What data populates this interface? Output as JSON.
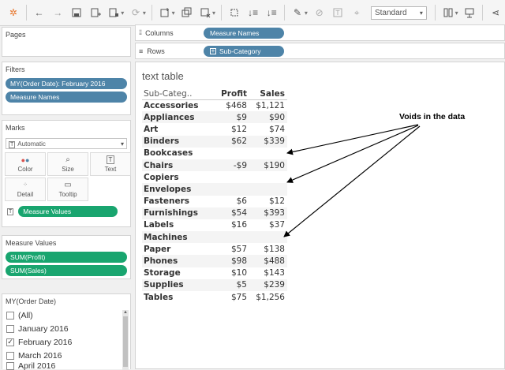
{
  "toolbar": {
    "format_select": "Standard"
  },
  "pages": {
    "title": "Pages"
  },
  "filters": {
    "title": "Filters",
    "pills": [
      "MY(Order Date): February 2016",
      "Measure Names"
    ]
  },
  "marks": {
    "title": "Marks",
    "type": "Automatic",
    "buttons": [
      {
        "label": "Color",
        "icon": "color-icon"
      },
      {
        "label": "Size",
        "icon": "size-icon"
      },
      {
        "label": "Text",
        "icon": "text-icon"
      },
      {
        "label": "Detail",
        "icon": "detail-icon"
      },
      {
        "label": "Tooltip",
        "icon": "tooltip-icon"
      }
    ],
    "measure_values_pill": "Measure Values"
  },
  "measure_values": {
    "title": "Measure Values",
    "pills": [
      "SUM(Profit)",
      "SUM(Sales)"
    ]
  },
  "date_filter": {
    "title": "MY(Order Date)",
    "items": [
      {
        "label": "(All)",
        "checked": false
      },
      {
        "label": "January 2016",
        "checked": false
      },
      {
        "label": "February 2016",
        "checked": true
      },
      {
        "label": "March 2016",
        "checked": false
      },
      {
        "label": "April 2016",
        "checked": false
      }
    ]
  },
  "shelves": {
    "columns_label": "Columns",
    "columns_pill": "Measure Names",
    "rows_label": "Rows",
    "rows_pill": "Sub-Category"
  },
  "view": {
    "title": "text table",
    "headers": [
      "Sub-Categ..",
      "Profit",
      "Sales"
    ],
    "rows": [
      [
        "Accessories",
        "$468",
        "$1,121"
      ],
      [
        "Appliances",
        "$9",
        "$90"
      ],
      [
        "Art",
        "$12",
        "$74"
      ],
      [
        "Binders",
        "$62",
        "$339"
      ],
      [
        "Bookcases",
        "",
        ""
      ],
      [
        "Chairs",
        "-$9",
        "$190"
      ],
      [
        "Copiers",
        "",
        ""
      ],
      [
        "Envelopes",
        "",
        ""
      ],
      [
        "Fasteners",
        "$6",
        "$12"
      ],
      [
        "Furnishings",
        "$54",
        "$393"
      ],
      [
        "Labels",
        "$16",
        "$37"
      ],
      [
        "Machines",
        "",
        ""
      ],
      [
        "Paper",
        "$57",
        "$138"
      ],
      [
        "Phones",
        "$98",
        "$488"
      ],
      [
        "Storage",
        "$10",
        "$143"
      ],
      [
        "Supplies",
        "$5",
        "$239"
      ],
      [
        "Tables",
        "$75",
        "$1,256"
      ]
    ],
    "annotation": "Voids in the data"
  },
  "colors": {
    "blue_pill": "#4e84a8",
    "green_pill": "#19a56f"
  }
}
